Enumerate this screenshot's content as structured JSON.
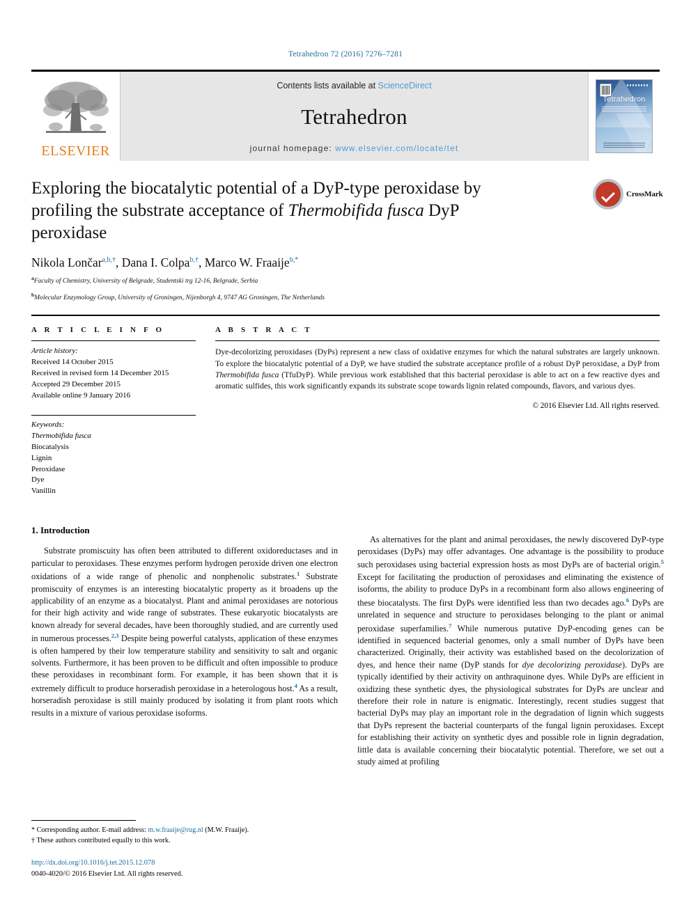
{
  "running_head": "Tetrahedron 72 (2016) 7276–7281",
  "masthead": {
    "publisher_name": "ELSEVIER",
    "contents_prefix": "Contents lists available at ",
    "contents_link": "ScienceDirect",
    "journal_name": "Tetrahedron",
    "homepage_prefix": "journal homepage: ",
    "homepage_url": "www.elsevier.com/locate/tet",
    "cover_title": "Tetrahedron"
  },
  "article": {
    "title_part1": "Exploring the biocatalytic potential of a DyP-type peroxidase by profiling the substrate acceptance of ",
    "title_italic": "Thermobifida fusca",
    "title_part2": " DyP peroxidase",
    "crossmark_label": "CrossMark",
    "authors_html": "Nikola Lončar<sup>a,b,†</sup>, Dana I. Colpa<sup>b,†</sup>, Marco W. Fraaije<sup>b,*</sup>",
    "affiliation_a": "Faculty of Chemistry, University of Belgrade, Studentski trg 12-16, Belgrade, Serbia",
    "affiliation_b": "Molecular Enzymology Group, University of Groningen, Nijenborgh 4, 9747 AG Groningen, The Netherlands"
  },
  "info": {
    "heading": "A R T I C L E   I N F O",
    "history_label": "Article history:",
    "history": [
      "Received 14 October 2015",
      "Received in revised form 14 December 2015",
      "Accepted 29 December 2015",
      "Available online 9 January 2016"
    ],
    "keywords_label": "Keywords:",
    "keywords": [
      "Thermobifida fusca",
      "Biocatalysis",
      "Lignin",
      "Peroxidase",
      "Dye",
      "Vanillin"
    ],
    "keywords_italic_index": 0
  },
  "abstract": {
    "heading": "A B S T R A C T",
    "text_1": "Dye-decolorizing peroxidases (DyPs) represent a new class of oxidative enzymes for which the natural substrates are largely unknown. To explore the biocatalytic potential of a DyP, we have studied the substrate acceptance profile of a robust DyP peroxidase, a DyP from ",
    "text_italic": "Thermobifida fusca",
    "text_2": " (TfuDyP). While previous work established that this bacterial peroxidase is able to act on a few reactive dyes and aromatic sulfides, this work significantly expands its substrate scope towards lignin related compounds, flavors, and various dyes.",
    "copyright": "© 2016 Elsevier Ltd. All rights reserved."
  },
  "body": {
    "section_heading": "1. Introduction",
    "left_p1_a": "Substrate promiscuity has often been attributed to different oxidoreductases and in particular to peroxidases. These enzymes perform hydrogen peroxide driven one electron oxidations of a wide range of phenolic and nonphenolic substrates.",
    "left_p1_ref1": "1",
    "left_p1_b": " Substrate promiscuity of enzymes is an interesting biocatalytic property as it broadens up the applicability of an enzyme as a biocatalyst. Plant and animal peroxidases are notorious for their high activity and wide range of substrates. These eukaryotic biocatalysts are known already for several decades, have been thoroughly studied, and are currently used in numerous processes.",
    "left_p1_ref2": "2,3",
    "left_p1_c": " Despite being powerful catalysts, application of these enzymes is often hampered by their low temperature stability and sensitivity to salt and organic solvents. Furthermore, it has been proven to be difficult and often impossible to produce these peroxidases in recombinant form. For example, it has been shown that it is extremely difficult to produce horseradish peroxidase in a heterologous host.",
    "left_p1_ref3": "4",
    "left_p1_d": " As a result, horseradish peroxidase is still mainly produced by isolating it from plant roots which results in a mixture of various peroxidase isoforms.",
    "right_p1_a": "As alternatives for the plant and animal peroxidases, the newly discovered DyP-type peroxidases (DyPs) may offer advantages. One advantage is the possibility to produce such peroxidases using bacterial expression hosts as most DyPs are of bacterial origin.",
    "right_p1_ref1": "5",
    "right_p1_b": " Except for facilitating the production of peroxidases and eliminating the existence of isoforms, the ability to produce DyPs in a recombinant form also allows engineering of these biocatalysts. The first DyPs were identified less than two decades ago.",
    "right_p1_ref2": "6",
    "right_p1_c": " DyPs are unrelated in sequence and structure to peroxidases belonging to the plant or animal peroxidase superfamilies.",
    "right_p1_ref3": "7",
    "right_p1_d": " While numerous putative DyP-encoding genes can be identified in sequenced bacterial genomes, only a small number of DyPs have been characterized. Originally, their activity was established based on the decolorization of dyes, and hence their name (DyP stands for ",
    "right_p1_italic": "dye decolorizing peroxidase",
    "right_p1_e": "). DyPs are typically identified by their activity on anthraquinone dyes. While DyPs are efficient in oxidizing these synthetic dyes, the physiological substrates for DyPs are unclear and therefore their role in nature is enigmatic. Interestingly, recent studies suggest that bacterial DyPs may play an important role in the degradation of lignin which suggests that DyPs represent the bacterial counterparts of the fungal lignin peroxidases. Except for establishing their activity on synthetic dyes and possible role in lignin degradation, little data is available concerning their biocatalytic potential. Therefore, we set out a study aimed at profiling"
  },
  "footnotes": {
    "corresponding_prefix": "* Corresponding author. E-mail address: ",
    "corresponding_email": "m.w.fraaije@rug.nl",
    "corresponding_suffix": " (M.W. Fraaije).",
    "equal_contribution": "† These authors contributed equally to this work."
  },
  "footer": {
    "doi": "http://dx.doi.org/10.1016/j.tet.2015.12.078",
    "issn_line": "0040-4020/© 2016 Elsevier Ltd. All rights reserved."
  },
  "colors": {
    "link_blue": "#1a6d9e",
    "elsevier_orange": "#E87B1E",
    "sciencedirect_blue": "#4c9bd4"
  }
}
